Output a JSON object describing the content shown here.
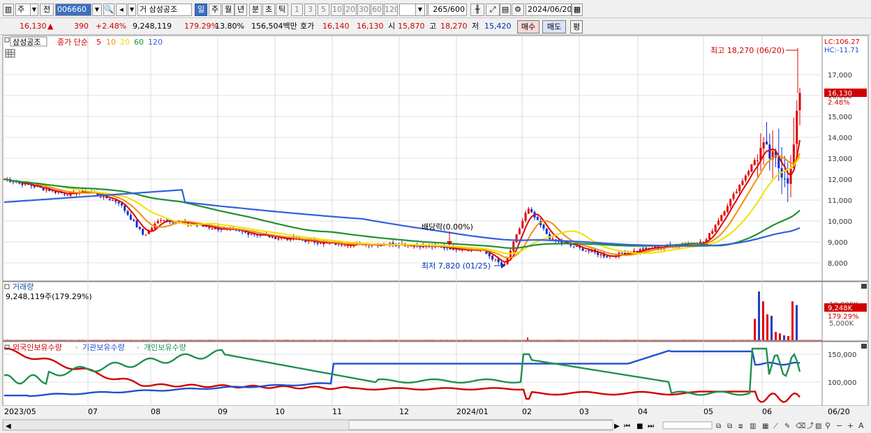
{
  "toolbar": {
    "market": "주",
    "prev_label": "전",
    "code": "006660",
    "order_type": "거",
    "stock_name": "삼성공조",
    "periods": [
      "일",
      "주",
      "월",
      "년",
      "분",
      "초",
      "틱"
    ],
    "selected_period": "일",
    "intervals": [
      "1",
      "3",
      "5",
      "10",
      "20",
      "30",
      "60",
      "120"
    ],
    "count": "265",
    "max_count": "/600",
    "date": "2024/06/20"
  },
  "quote": {
    "price": "16,130",
    "arrow": "▲",
    "change": "390",
    "change_pct": "+2.48%",
    "volume": "9,248,119",
    "volume_ratio": "179.29%",
    "turnover": "13.80%",
    "amount": "156,504백만",
    "ask_label": "호가",
    "ask": "16,140",
    "bid": "16,130",
    "open_label": "시",
    "open": "15,870",
    "high_label": "고",
    "high": "18,270",
    "low_label": "저",
    "low": "15,420",
    "buy_label": "매수",
    "sell_label": "매도",
    "eval_label": "평"
  },
  "price_panel": {
    "legend_name": "삼성공조",
    "legend_text": "종가 단순",
    "ma_periods": [
      "5",
      "10",
      "20",
      "60",
      "120"
    ],
    "ma_colors": [
      "#e00000",
      "#f09000",
      "#f0e000",
      "#209030",
      "#3060e0"
    ],
    "annotation_high": "최고 18,270 (06/20)",
    "annotation_low": "최저 7,820 (01/25)",
    "annotation_dividend": "배당락(0.00%)",
    "lc_label": "LC:106.27",
    "hc_label": "HC:-11.71",
    "current_price_label": "16,130",
    "current_pct_label": "2.48%"
  },
  "volume_panel": {
    "title": "거래량",
    "info": "9,248,119주(179.29%)",
    "axis_label": "5,000K",
    "axis_label_top": "10,000K",
    "current_label": "9,248K",
    "current_pct": "179.29%"
  },
  "holding_panel": {
    "legend": [
      "외국인보유수량",
      "기관보유수량",
      "개인보유수량"
    ],
    "legend_colors": [
      "#d00000",
      "#2050d0",
      "#209050"
    ],
    "axis_labels": [
      "150,000",
      "100,000"
    ]
  },
  "x_axis": {
    "labels": [
      "2023/05",
      "07",
      "08",
      "09",
      "10",
      "11",
      "12",
      "2024/01",
      "02",
      "03",
      "04",
      "05",
      "06"
    ],
    "end_label": "06/20"
  },
  "chart_data": [
    {
      "type": "candlestick",
      "title": "삼성공조",
      "x_range": [
        "2023/05",
        "2024/06/20"
      ],
      "ylim": [
        7500,
        18500
      ],
      "y_ticks": [
        8000,
        9000,
        10000,
        11000,
        12000,
        13000,
        14000,
        15000,
        16000,
        17000
      ],
      "close_path": [
        [
          "2023/05",
          12000
        ],
        [
          "2023/06",
          11300
        ],
        [
          "2023/07",
          11400
        ],
        [
          "2023/07 late",
          10900
        ],
        [
          "2023/08 early",
          9300
        ],
        [
          "2023/08",
          10100
        ],
        [
          "2023/09",
          9700
        ],
        [
          "2023/10",
          9200
        ],
        [
          "2023/11",
          8900
        ],
        [
          "2023/12",
          8900
        ],
        [
          "2024/01",
          8600
        ],
        [
          "2024/01/25",
          7820
        ],
        [
          "2024/02 early",
          10600
        ],
        [
          "2024/02",
          9100
        ],
        [
          "2024/03",
          8300
        ],
        [
          "2024/04",
          8700
        ],
        [
          "2024/05",
          9000
        ],
        [
          "2024/06 early",
          13500
        ],
        [
          "2024/06 mid",
          12000
        ],
        [
          "2024/06/20",
          16130
        ]
      ],
      "ma_last": {
        "5": 14400,
        "10": 14000,
        "20": 12500,
        "60": 10050,
        "120": 9350
      },
      "high": 18270,
      "low": 7820
    },
    {
      "type": "bar",
      "title": "거래량",
      "unit": "K",
      "recent_volumes_k": [
        5600,
        12800,
        10200,
        6800,
        6400,
        2200,
        1800,
        1300,
        1100,
        10200,
        9248
      ]
    },
    {
      "type": "line",
      "series": [
        {
          "name": "외국인보유수량",
          "color": "#d00000",
          "trend": "decline from ~158,000 to ~75,000"
        },
        {
          "name": "기관보유수량",
          "color": "#2050d0",
          "trend": "rise from ~74,000 to ~157,000"
        },
        {
          "name": "개인보유수량",
          "color": "#209050",
          "trend": "oscillating 90,000–160,000"
        }
      ],
      "y_ticks": [
        100000,
        150000
      ]
    }
  ],
  "status": {
    "scroll_label": ""
  }
}
